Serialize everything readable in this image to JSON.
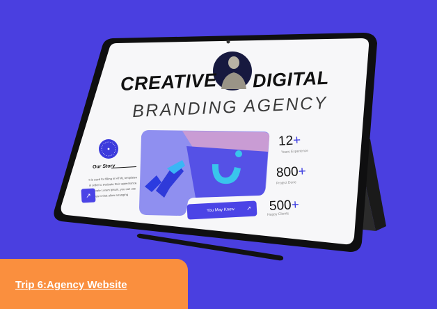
{
  "hero": {
    "line1_left": "CREATIVE",
    "line1_right": "DIGITAL",
    "line2": "BRANDING AGENCY"
  },
  "story": {
    "title": "Our Story",
    "text": "It is used for filling in HTML templates in order to evaluate their appearance. generate Lorem Ipsum, you can use various is that allow arranging"
  },
  "stats": [
    {
      "value": "12",
      "suffix": "+",
      "label": "Years Experience"
    },
    {
      "value": "800",
      "suffix": "+",
      "label": "Project Done"
    },
    {
      "value": "500",
      "suffix": "+",
      "label": "Happy Clients"
    }
  ],
  "cta": {
    "label": "You May Know",
    "arrow": "↗"
  },
  "story_arrow": "↗",
  "banner": {
    "title": "Trip 6:Agency Website"
  },
  "colors": {
    "background": "#4a3fe0",
    "accent": "#4b44e6",
    "banner": "#fa8f3e"
  }
}
